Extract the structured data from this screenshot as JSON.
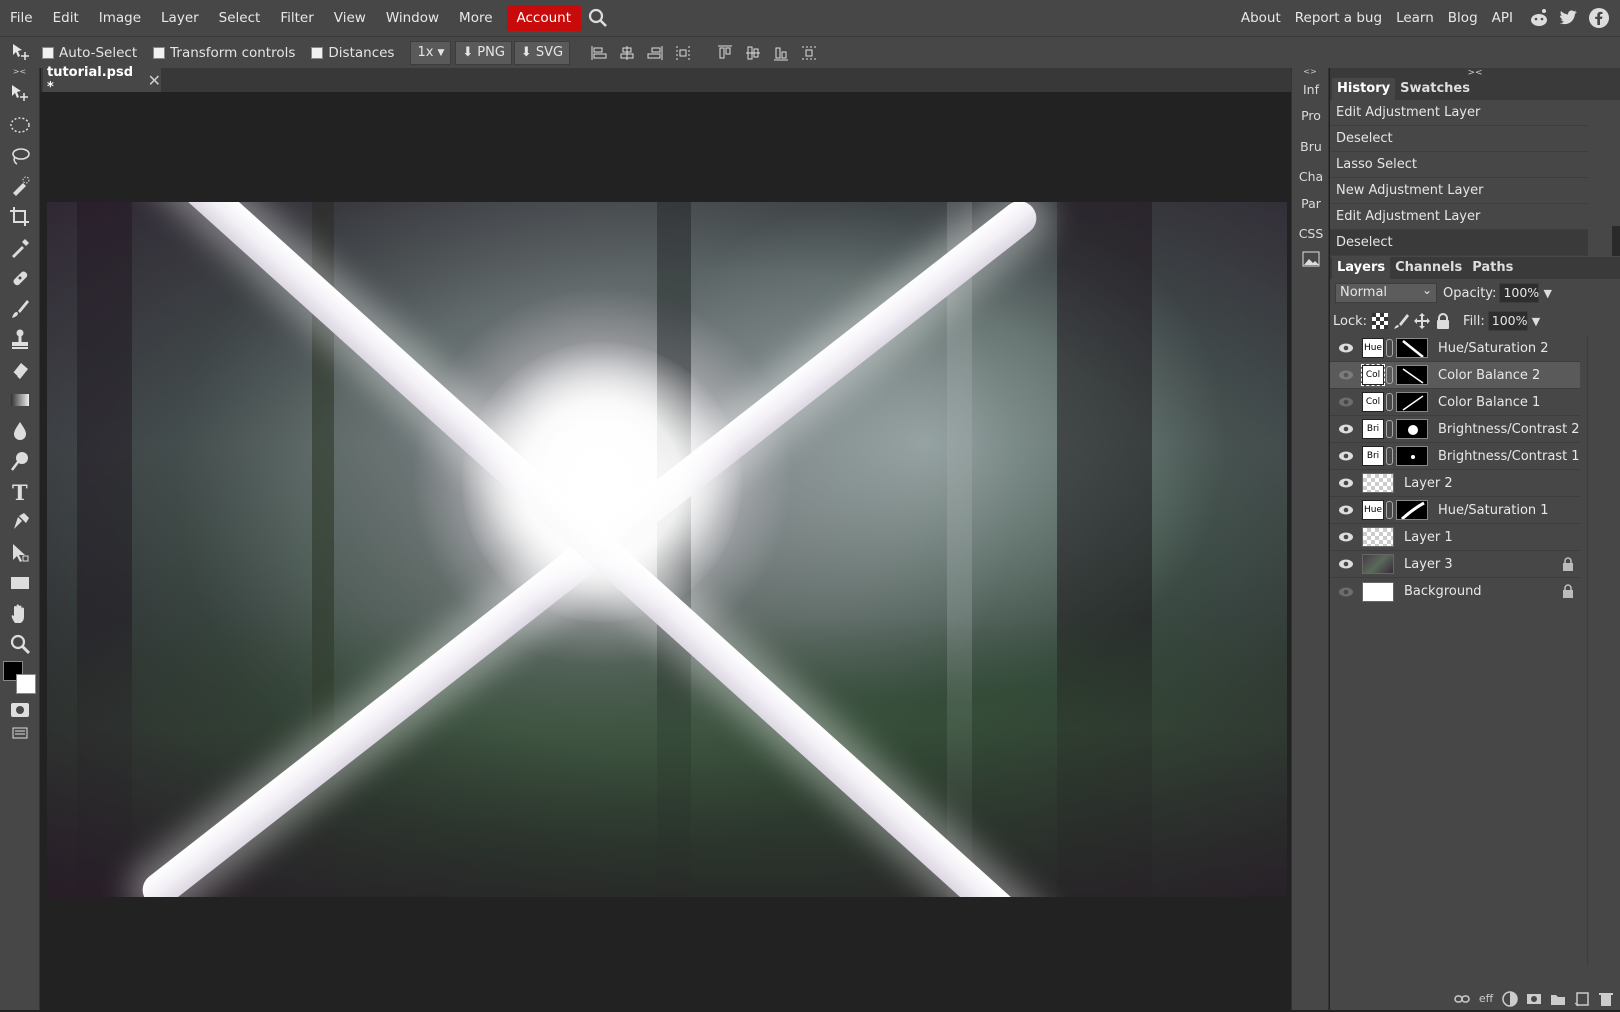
{
  "menu": {
    "items": [
      "File",
      "Edit",
      "Image",
      "Layer",
      "Select",
      "Filter",
      "View",
      "Window",
      "More"
    ],
    "account": "Account",
    "right_items": [
      "About",
      "Report a bug",
      "Learn",
      "Blog",
      "API"
    ]
  },
  "options": {
    "auto_select": "Auto-Select",
    "transform_controls": "Transform controls",
    "distances": "Distances",
    "scale": "1x",
    "png": "PNG",
    "svg": "SVG"
  },
  "document": {
    "tab_title": "tutorial.psd *",
    "close_glyph": "✕"
  },
  "right_strip": [
    "Inf",
    "Pro",
    "Bru",
    "Cha",
    "Par",
    "CSS"
  ],
  "history": {
    "tabs": [
      "History",
      "Swatches"
    ],
    "items": [
      "Edit Adjustment Layer",
      "Deselect",
      "Lasso Select",
      "New Adjustment Layer",
      "Edit Adjustment Layer",
      "Deselect"
    ]
  },
  "layers_panel": {
    "tabs": [
      "Layers",
      "Channels",
      "Paths"
    ],
    "blend_mode": "Normal",
    "opacity_label": "Opacity:",
    "opacity_value": "100%",
    "lock_label": "Lock:",
    "fill_label": "Fill:",
    "fill_value": "100%",
    "layers": [
      {
        "name": "Hue/Saturation 2",
        "kind": "Hue",
        "visible": true,
        "selected": false
      },
      {
        "name": "Color Balance 2",
        "kind": "Col",
        "visible": false,
        "selected": true
      },
      {
        "name": "Color Balance 1",
        "kind": "Col",
        "visible": false,
        "selected": false
      },
      {
        "name": "Brightness/Contrast 2",
        "kind": "Bri",
        "visible": true,
        "selected": false
      },
      {
        "name": "Brightness/Contrast 1",
        "kind": "Bri",
        "visible": true,
        "selected": false
      },
      {
        "name": "Layer 2",
        "kind": "raster",
        "visible": true,
        "selected": false
      },
      {
        "name": "Hue/Saturation 1",
        "kind": "Hue",
        "visible": true,
        "selected": false
      },
      {
        "name": "Layer 1",
        "kind": "raster",
        "visible": true,
        "selected": false
      },
      {
        "name": "Layer 3",
        "kind": "photo",
        "visible": true,
        "selected": false,
        "locked": true
      },
      {
        "name": "Background",
        "kind": "white",
        "visible": false,
        "selected": false,
        "locked": true
      }
    ]
  },
  "bottom_icons": {
    "eff": "eff"
  },
  "colors": {
    "accent": "#c80a0a",
    "panel": "#474747",
    "workspace": "#222222"
  }
}
